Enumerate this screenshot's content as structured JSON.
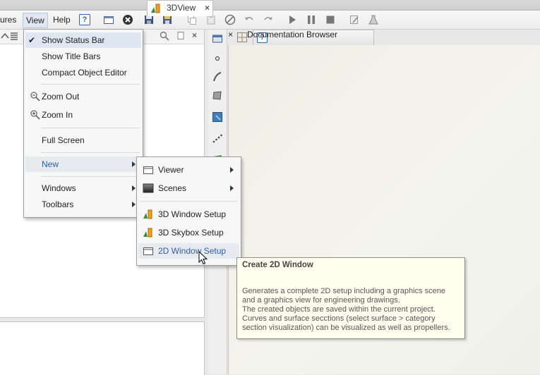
{
  "menubar": {
    "items": [
      {
        "label": "ures"
      },
      {
        "label": "View"
      },
      {
        "label": "Help"
      }
    ]
  },
  "toolbar": {
    "icons": [
      "help-icon",
      "new-window-icon",
      "close-circle-icon",
      "save-icon",
      "save-all-icon",
      "copy-icon",
      "paste-icon",
      "cancel-icon",
      "undo-icon",
      "redo-icon",
      "play-icon",
      "pause-icon",
      "stop-icon",
      "edit-icon",
      "flask-icon"
    ]
  },
  "tabs": [
    {
      "label": "Documentation Browser",
      "close": "×"
    },
    {
      "label": "3DView",
      "close": "×"
    }
  ],
  "view_menu": {
    "items": [
      {
        "label": "Show Status Bar",
        "checked": "✔"
      },
      {
        "label": "Show Title Bars"
      },
      {
        "label": "Compact Object Editor"
      },
      {
        "label": "Zoom Out"
      },
      {
        "label": "Zoom In"
      },
      {
        "label": "Full Screen"
      },
      {
        "label": "New"
      },
      {
        "label": "Windows"
      },
      {
        "label": "Toolbars"
      }
    ]
  },
  "new_submenu": {
    "items": [
      {
        "label": "Viewer"
      },
      {
        "label": "Scenes"
      },
      {
        "label": "3D Window Setup"
      },
      {
        "label": "3D Skybox Setup"
      },
      {
        "label": "2D Window Setup"
      }
    ]
  },
  "tooltip": {
    "title": "Create 2D Window",
    "lines": [
      "Generates a complete 2D setup including a graphics scene",
      "and a graphics view for engineering drawings.",
      "The created objects are saved within the current project.",
      "Curves and surface secctions (select surface > category",
      "section visualization) can be visualized as well as propellers."
    ]
  },
  "colors": {
    "accent": "#2f5fa7",
    "highlight": "#dde6f1"
  }
}
